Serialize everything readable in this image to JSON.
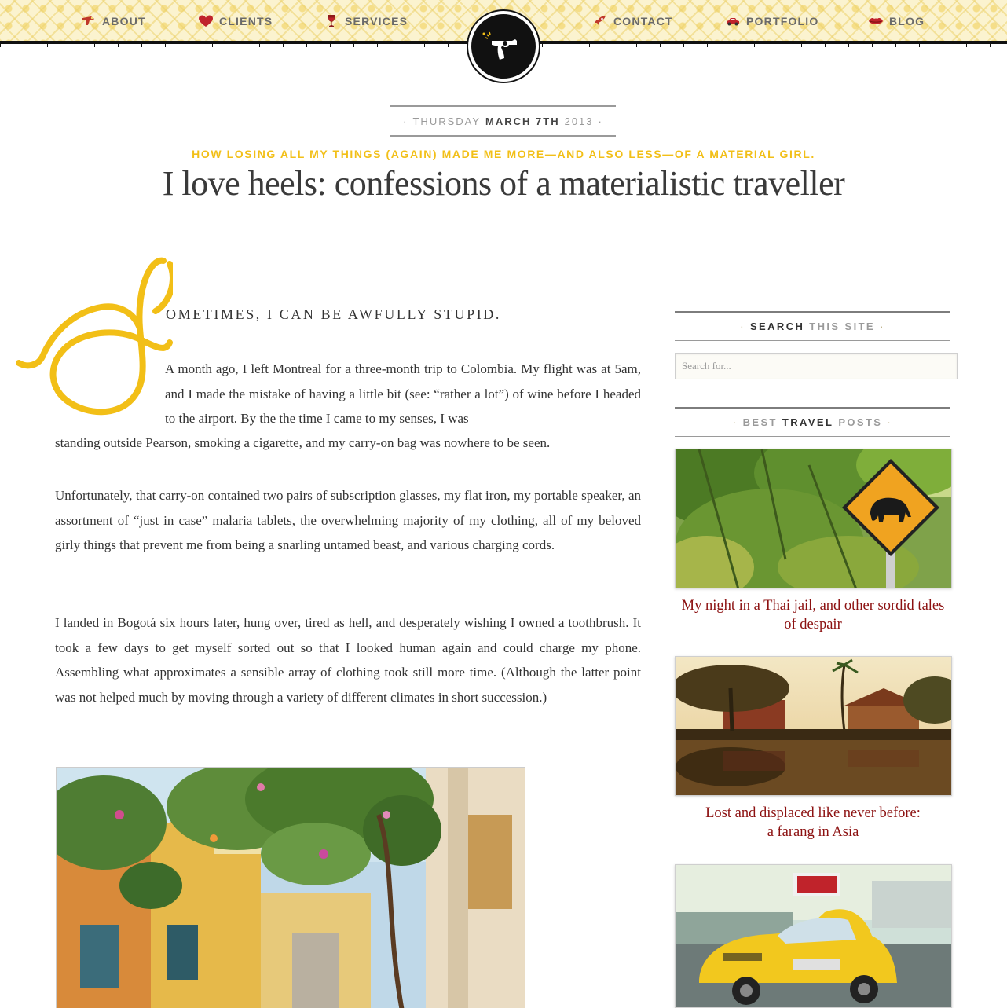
{
  "nav": {
    "left": [
      {
        "label": "ABOUT",
        "icon": "raygun-icon"
      },
      {
        "label": "CLIENTS",
        "icon": "heart-icon"
      },
      {
        "label": "SERVICES",
        "icon": "wine-glass-icon"
      }
    ],
    "right": [
      {
        "label": "CONTACT",
        "icon": "rocket-icon"
      },
      {
        "label": "PORTFOLIO",
        "icon": "car-icon"
      },
      {
        "label": "BLOG",
        "icon": "lips-icon"
      }
    ],
    "logo_icon": "revolver-icon"
  },
  "post": {
    "date": {
      "dot": "·",
      "weekday": "THURSDAY",
      "month_day": "MARCH 7TH",
      "year": "2013"
    },
    "kicker": "HOW LOSING ALL MY THINGS (AGAIN) MADE ME MORE—AND ALSO LESS—OF A MATERIAL GIRL.",
    "title": "I love heels: confessions of a materialistic traveller",
    "dropcap_letter": "S",
    "lead": "ometimes, I can be awfully stupid.",
    "p1_a": "A month ago, I left Montreal for a three-month trip to Colombia. My flight was at 5am, and I made the mistake of having a little bit (see: “rather a lot”) of wine before I headed to the airport. By the the time I came to my senses, I was",
    "p1_b": "standing outside Pearson, smoking a cigarette, and my carry-on bag was nowhere to be seen.",
    "p2": "Unfortunately, that carry-on contained two pairs of subscription glasses, my flat iron, my portable speaker, an assortment of “just in case” malaria tablets, the overwhelming majority of my clothing, all of my beloved girly things that prevent me from being a snarling untamed beast, and various charging cords.",
    "p3": "I landed in Bogotá six hours later, hung over, tired as hell, and desperately wishing I owned a toothbrush. It took a few days to get myself sorted out so that I looked human again and could charge my phone. Assembling what approximates a sensible array of clothing took still more time. (Although the latter point was not helped much by moving through a variety of different climates in short succession.)"
  },
  "sidebar": {
    "search": {
      "heading_dark": "SEARCH",
      "heading_light": "THIS SITE",
      "placeholder": "Search for..."
    },
    "travel": {
      "heading_light_1": "BEST",
      "heading_dark": "TRAVEL",
      "heading_light_2": "POSTS",
      "posts": [
        {
          "title": "My night in a Thai jail, and other sordid tales\nof despair"
        },
        {
          "title": "Lost and displaced like never before:\na farang in Asia"
        },
        {
          "title": ""
        }
      ]
    }
  },
  "colors": {
    "accent_yellow": "#f2bf17",
    "link_red": "#8c1111",
    "text": "#333333",
    "header_bg": "#fbf3cf"
  }
}
